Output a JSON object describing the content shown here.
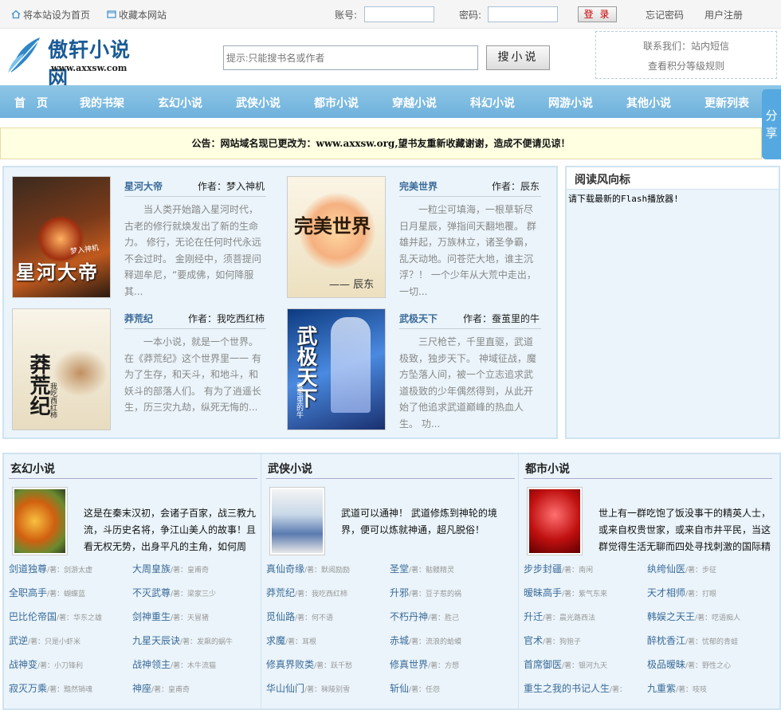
{
  "topbar": {
    "set_home": "将本站设为首页",
    "bookmark": "收藏本网站",
    "account_label": "账号:",
    "password_label": "密码:",
    "login_button": "登 录",
    "forgot_password": "忘记密码",
    "register": "用户注册"
  },
  "header": {
    "logo_text": "傲轩小说网",
    "logo_url": "www.axxsw.com",
    "search_placeholder": "提示:只能搜书名或作者",
    "search_button": "搜小说",
    "contact_line": "联系我们：站内短信",
    "points_rules": "查看积分等级规则"
  },
  "nav": [
    "首　页",
    "我的书架",
    "玄幻小说",
    "武侠小说",
    "都市小说",
    "穿越小说",
    "科幻小说",
    "网游小说",
    "其他小说",
    "更新列表"
  ],
  "share": "分享",
  "notice": "公告：网站域名现已更改为：www.axxsw.org,望书友重新收藏谢谢，造成不便请见谅！",
  "featured": [
    {
      "title": "星河大帝",
      "author": "作者：梦入神机",
      "desc": "当人类开始踏入星河时代，古老的修行就焕发出了新的生命力。 修行，无论在任何时代永远不会过时。 金刚经中，须菩提问释迦牟尼，“要成佛，如何降服其...",
      "cover_title": "星河大帝",
      "cover_sub": "梦入神机"
    },
    {
      "title": "完美世界",
      "author": "作者：辰东",
      "desc": "一粒尘可填海，一根草斩尽日月星辰，弹指间天翻地覆。 群雄并起，万族林立，诸圣争霸，乱天动地。问苍茫大地，谁主沉浮？！ 一个少年从大荒中走出，一切...",
      "cover_title": "完美世界",
      "cover_sub": "—— 辰东"
    },
    {
      "title": "莽荒纪",
      "author": "作者：我吃西红柿",
      "desc": "一本小说，就是一个世界。 在《莽荒纪》这个世界里一一 有为了生存，和天斗，和地斗，和妖斗的部落人们。 有为了逍遥长生，历三灾九劫，纵死无悔的...",
      "cover_title": "莽荒纪",
      "cover_sub": "我吃西红柿"
    },
    {
      "title": "武极天下",
      "author": "作者：蚕茧里的牛",
      "desc": "三尺枪芒，千里直驱，武道极致，独步天下。 神域征战，魔方坠落人间，被一个立志追求武道极致的少年偶然得到，从此开始了他追求武道巅峰的热血人生。 功...",
      "cover_title": "武极天下",
      "cover_sub": "蚕茧里的牛"
    }
  ],
  "sidebar": {
    "title": "阅读风向标",
    "content": "请下载最新的Flash播放器!"
  },
  "categories": [
    {
      "title": "玄幻小说",
      "intro": "这是在秦末汉初，会诸子百家，战三教九流，斗历史名将，争江山美人的故事！且看无权无势，出身平凡的主角，如何周",
      "books": [
        {
          "name": "剑道独尊",
          "author": "/著：剑游太虚"
        },
        {
          "name": "大周皇族",
          "author": "/著：皇甫奇"
        },
        {
          "name": "全职高手",
          "author": "/著：蝴蝶蓝"
        },
        {
          "name": "不灭武尊",
          "author": "/著：梁家三少"
        },
        {
          "name": "巴比伦帝国",
          "author": "/著：华东之雄"
        },
        {
          "name": "剑神重生",
          "author": "/著：天冒猪"
        },
        {
          "name": "武逆",
          "author": "/著：只是小虾米"
        },
        {
          "name": "九星天辰诀",
          "author": "/著：发飙的蜗牛"
        },
        {
          "name": "战神变",
          "author": "/著：小刀锋利"
        },
        {
          "name": "战神领主",
          "author": "/著：木牛流猫"
        },
        {
          "name": "寂灭万乘",
          "author": "/著：黯然销魂"
        },
        {
          "name": "神座",
          "author": "/著：皇甫奇"
        }
      ]
    },
    {
      "title": "武侠小说",
      "intro": "武道可以通神！ 武道修炼到神轮的境界，便可以炼就神通，超凡脱俗！",
      "books": [
        {
          "name": "真仙奇缘",
          "author": "/著：默阅励励"
        },
        {
          "name": "圣堂",
          "author": "/著：骷髅精灵"
        },
        {
          "name": "莽荒纪",
          "author": "/著：我吃西红柿"
        },
        {
          "name": "升邪",
          "author": "/著：豆子惹的祸"
        },
        {
          "name": "觅仙路",
          "author": "/著：何不语"
        },
        {
          "name": "不朽丹神",
          "author": "/著：胜己"
        },
        {
          "name": "求魔",
          "author": "/著：耳根"
        },
        {
          "name": "赤城",
          "author": "/著：流浪的蛤蟆"
        },
        {
          "name": "修真界败类",
          "author": "/著：跃千愁"
        },
        {
          "name": "修真世界",
          "author": "/著：方想"
        },
        {
          "name": "华山仙门",
          "author": "/著：秣陵别雪"
        },
        {
          "name": "斩仙",
          "author": "/著：任怨"
        }
      ]
    },
    {
      "title": "都市小说",
      "intro": "世上有一群吃饱了饭没事干的精英人士，或来自权贵世家，或来自市井平民，当这群觉得生活无聊而四处寻找刺激的国际精",
      "books": [
        {
          "name": "步步封疆",
          "author": "/著：南闲"
        },
        {
          "name": "纨绔仙医",
          "author": "/著：步征"
        },
        {
          "name": "暧昧高手",
          "author": "/著：紫气东来"
        },
        {
          "name": "天才相师",
          "author": "/著：打眼"
        },
        {
          "name": "升迁",
          "author": "/著：晨光路西法"
        },
        {
          "name": "韩娱之天王",
          "author": "/著：呓语痴人"
        },
        {
          "name": "官术",
          "author": "/著：狗狍子"
        },
        {
          "name": "醉枕香江",
          "author": "/著：忧郁的青蛙"
        },
        {
          "name": "首席御医",
          "author": "/著：银河九天"
        },
        {
          "name": "极品暧昧",
          "author": "/著：野性之心"
        },
        {
          "name": "重生之我的书记人生",
          "author": "/著："
        },
        {
          "name": "九重紫",
          "author": "/著：吱吱"
        }
      ]
    }
  ]
}
